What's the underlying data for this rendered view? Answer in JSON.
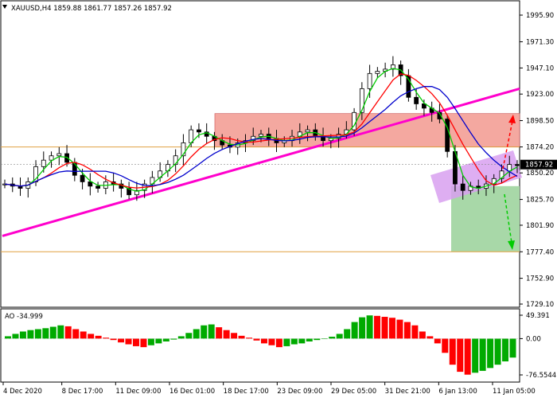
{
  "header": {
    "symbol": "XAUUSD,H4",
    "open": "1859.88",
    "high": "1861.77",
    "low": "1857.26",
    "close": "1857.92"
  },
  "price_axis": {
    "ticks": [
      "1995.90",
      "1971.30",
      "1947.10",
      "1923.00",
      "1898.50",
      "1874.20",
      "1850.20",
      "1825.70",
      "1801.90",
      "1777.40",
      "1752.90",
      "1729.10"
    ],
    "current_price": "1857.92"
  },
  "ao_panel": {
    "label": "AO -34.999",
    "ticks": [
      "49.391",
      "0.00",
      "-76.5544"
    ]
  },
  "time_axis": {
    "ticks": [
      "4 Dec 2020",
      "8 Dec 17:00",
      "11 Dec 09:00",
      "16 Dec 01:00",
      "18 Dec 17:00",
      "23 Dec 09:00",
      "29 Dec 05:00",
      "31 Dec 21:00",
      "6 Jan 13:00",
      "11 Jan 05:00"
    ]
  },
  "colors": {
    "candles": "#000000",
    "ma_fast": "#00cc00",
    "ma_mid": "#ff0000",
    "ma_slow": "#0000cc",
    "trendline": "#ff00cc",
    "resistance_zone": "#f4a8a0",
    "support_zone": "#a8d8a8",
    "forecast_zone": "#d8a0f0",
    "level_line": "#e0a040",
    "ao_up": "#00aa00",
    "ao_down": "#ff0000",
    "arrow_up": "#ff0000",
    "arrow_down": "#00cc00"
  },
  "chart_data": {
    "type": "candlestick",
    "symbol": "XAUUSD",
    "timeframe": "H4",
    "price_range": [
      1729.1,
      1995.9
    ],
    "zones": [
      {
        "name": "resistance",
        "low": 1874.2,
        "high": 1905.0
      },
      {
        "name": "support",
        "low": 1777.4,
        "high": 1838.0
      }
    ],
    "levels": [
      1874.2,
      1777.4
    ],
    "trendline": {
      "start": 1792,
      "end": 1928
    },
    "close_series": [
      1840,
      1838,
      1836,
      1842,
      1856,
      1862,
      1866,
      1868,
      1860,
      1848,
      1842,
      1838,
      1836,
      1842,
      1840,
      1836,
      1830,
      1834,
      1840,
      1846,
      1852,
      1858,
      1866,
      1878,
      1890,
      1888,
      1884,
      1880,
      1876,
      1874,
      1878,
      1880,
      1884,
      1886,
      1882,
      1878,
      1880,
      1884,
      1888,
      1890,
      1884,
      1880,
      1882,
      1886,
      1890,
      1906,
      1928,
      1942,
      1944,
      1946,
      1950,
      1940,
      1920,
      1914,
      1910,
      1906,
      1900,
      1870,
      1840,
      1834,
      1838,
      1836,
      1840,
      1845,
      1852,
      1858,
      1857
    ],
    "ao_values": [
      5,
      10,
      15,
      18,
      20,
      22,
      25,
      28,
      26,
      20,
      15,
      10,
      6,
      2,
      -3,
      -8,
      -12,
      -16,
      -18,
      -14,
      -10,
      -6,
      -2,
      5,
      12,
      20,
      28,
      30,
      24,
      18,
      12,
      6,
      2,
      -4,
      -10,
      -14,
      -18,
      -16,
      -12,
      -10,
      -6,
      -3,
      0,
      4,
      10,
      20,
      35,
      45,
      49,
      48,
      46,
      44,
      40,
      35,
      28,
      15,
      5,
      -10,
      -30,
      -55,
      -70,
      -76,
      -72,
      -68,
      -62,
      -55,
      -48,
      -40
    ]
  }
}
